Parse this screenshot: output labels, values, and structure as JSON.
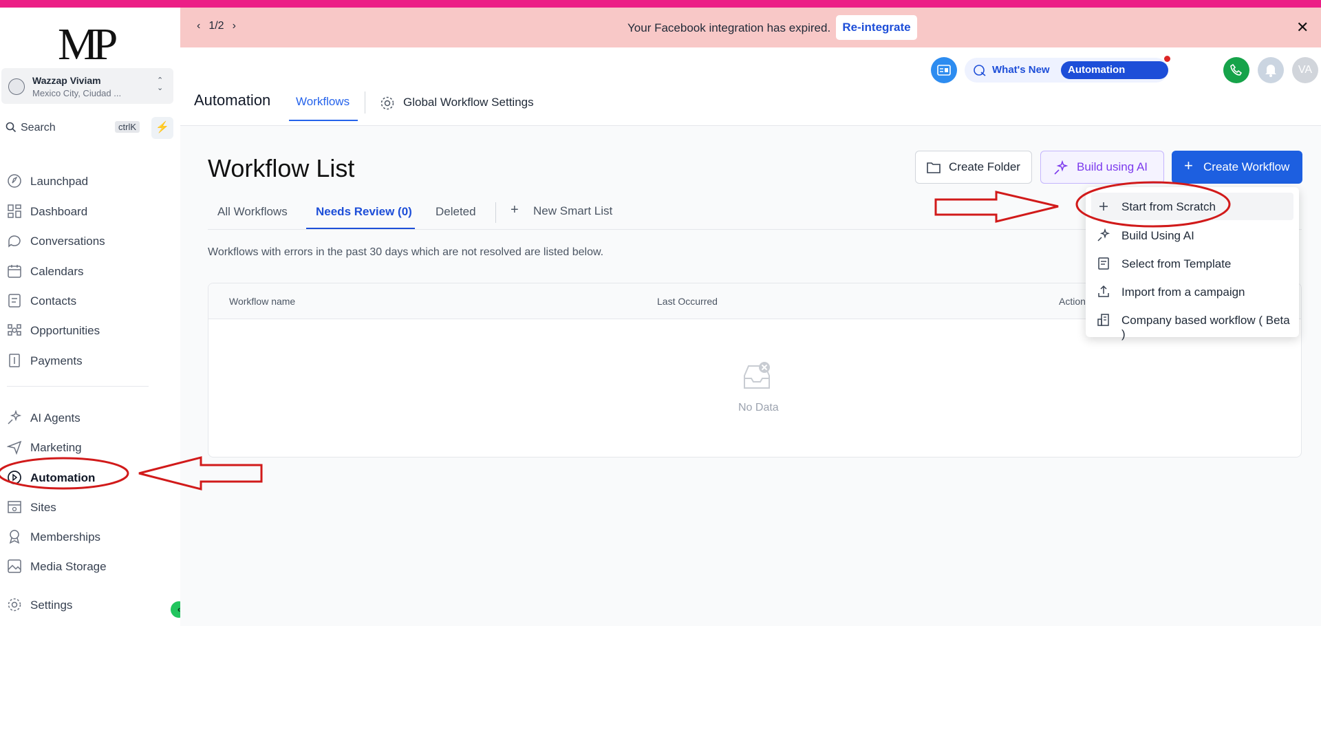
{
  "logo": {
    "text": "MP"
  },
  "account": {
    "name": "Wazzap Viviam",
    "location": "Mexico City, Ciudad ..."
  },
  "search": {
    "label": "Search",
    "shortcut": "ctrlK"
  },
  "sidebar": {
    "items": [
      {
        "label": "Launchpad",
        "icon": "rocket-icon"
      },
      {
        "label": "Dashboard",
        "icon": "grid-icon"
      },
      {
        "label": "Conversations",
        "icon": "chat-icon"
      },
      {
        "label": "Calendars",
        "icon": "calendar-icon"
      },
      {
        "label": "Contacts",
        "icon": "contacts-icon"
      },
      {
        "label": "Opportunities",
        "icon": "opportunities-icon"
      },
      {
        "label": "Payments",
        "icon": "payments-icon"
      },
      {
        "label": "AI Agents",
        "icon": "sparkle-icon"
      },
      {
        "label": "Marketing",
        "icon": "send-icon"
      },
      {
        "label": "Automation",
        "icon": "automation-icon"
      },
      {
        "label": "Sites",
        "icon": "sites-icon"
      },
      {
        "label": "Memberships",
        "icon": "medal-icon"
      },
      {
        "label": "Media Storage",
        "icon": "image-icon"
      },
      {
        "label": "Settings",
        "icon": "gear-icon"
      }
    ],
    "active": "Automation"
  },
  "banner": {
    "pager": "1/2",
    "message": "Your Facebook integration has expired.",
    "action": "Re-integrate"
  },
  "header": {
    "whats_new": "What's New",
    "updates_badge": "Automation Updates",
    "avatar_initials": "VA",
    "app_title": "Automation",
    "tabs": {
      "workflows": "Workflows",
      "global_settings": "Global Workflow Settings"
    }
  },
  "page": {
    "title": "Workflow List",
    "create_folder": "Create Folder",
    "build_ai": "Build using AI",
    "create_workflow": "Create Workflow",
    "subtabs": {
      "all": "All Workflows",
      "needs_review": "Needs Review (0)",
      "deleted": "Deleted",
      "new_smart_list": "New Smart List"
    },
    "note": "Workflows with errors in the past 30 days which are not resolved are listed below.",
    "table": {
      "columns": [
        "Workflow name",
        "Last Occurred",
        "Action"
      ],
      "empty": "No Data"
    }
  },
  "create_menu": {
    "items": [
      {
        "label": "Start from Scratch",
        "icon": "plus-icon"
      },
      {
        "label": "Build Using AI",
        "icon": "sparkle-icon"
      },
      {
        "label": "Select from Template",
        "icon": "template-icon"
      },
      {
        "label": "Import from a campaign",
        "icon": "upload-icon"
      },
      {
        "label": "Company based workflow ( Beta )",
        "icon": "building-icon"
      }
    ]
  },
  "colors": {
    "primary": "#1d4ed8",
    "banner": "#f8c8c7",
    "topbar": "#ec1f86",
    "annotation": "#d11a1a",
    "ai_purple": "#7c3aed"
  }
}
